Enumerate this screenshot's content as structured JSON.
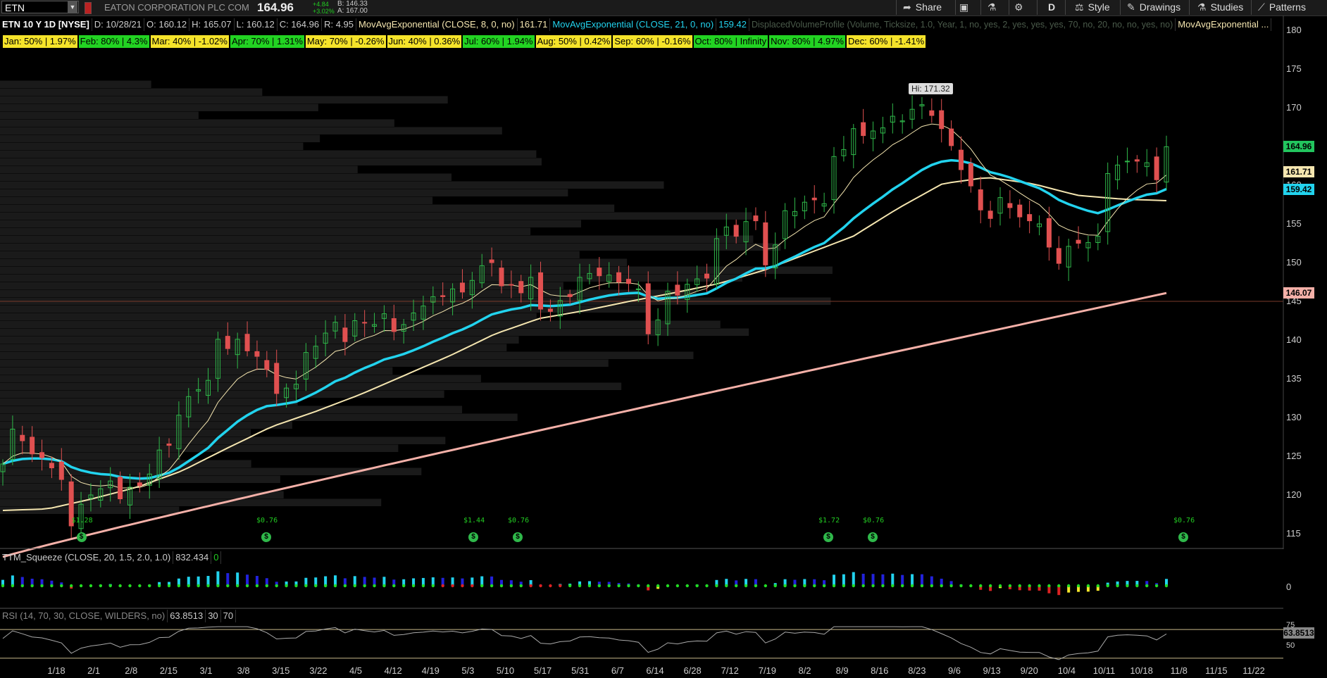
{
  "topbar": {
    "symbol": "ETN",
    "description": "EATON CORPORATION PLC COM",
    "last": "164.96",
    "change": "+4.84",
    "change_pct": "+3.02%",
    "bid": "B: 146.33",
    "ask": "A: 167.00",
    "buttons": {
      "share": "Share",
      "aggregation": "D",
      "style": "Style",
      "drawings": "Drawings",
      "studies": "Studies",
      "patterns": "Patterns"
    }
  },
  "infobar": {
    "title": "ETN 10 Y 1D [NYSE]",
    "date": "D: 10/28/21",
    "open": "O: 160.12",
    "high": "H: 165.07",
    "low": "L: 160.12",
    "close": "C: 164.96",
    "range": "R: 4.95",
    "ema8_label": "MovAvgExponential (CLOSE, 8, 0, no)",
    "ema8_value": "161.71",
    "ema21_label": "MovAvgExponential (CLOSE, 21, 0, no)",
    "ema21_value": "159.42",
    "dvp_label": "DisplacedVolumeProfile (Volume, Ticksize, 1.0, Year, 1, no, yes, 2, yes, yes, yes, 70, no, 20, no, no, yes, no)",
    "ema_more": "MovAvgExponential ..."
  },
  "seasonality": [
    {
      "text": "Jan: 50% | 1.97%",
      "color": "#f5e32a"
    },
    {
      "text": "Feb: 80% | 4.3%",
      "color": "#22d322"
    },
    {
      "text": "Mar: 40% | -1.02%",
      "color": "#f5e32a"
    },
    {
      "text": "Apr: 70% | 1.31%",
      "color": "#22d322"
    },
    {
      "text": "May: 70% | -0.26%",
      "color": "#f5e32a"
    },
    {
      "text": "Jun: 40% | 0.36%",
      "color": "#f5e32a"
    },
    {
      "text": "Jul: 60% | 1.94%",
      "color": "#22d322"
    },
    {
      "text": "Aug: 50% | 0.42%",
      "color": "#f5e32a"
    },
    {
      "text": "Sep: 60% | -0.16%",
      "color": "#f5e32a"
    },
    {
      "text": "Oct: 80% | Infinity",
      "color": "#22d322"
    },
    {
      "text": "Nov: 80% | 4.97%",
      "color": "#22d322"
    },
    {
      "text": "Dec: 60% | -1.41%",
      "color": "#f5e32a"
    }
  ],
  "price_tags": [
    {
      "value": "164.96",
      "color": "#22c55e"
    },
    {
      "value": "161.71",
      "color": "#f5e6b0"
    },
    {
      "value": "159.42",
      "color": "#22d3ee"
    },
    {
      "value": "146.07",
      "color": "#f4b0a8"
    }
  ],
  "hi_label": "Hi: 171.32",
  "events": [
    {
      "label": "$1.28"
    },
    {
      "label": "$0.76"
    },
    {
      "label": "$1.44"
    },
    {
      "label": "$0.76"
    },
    {
      "label": "$1.72"
    },
    {
      "label": "$0.76"
    },
    {
      "label": "$0.76"
    }
  ],
  "ttm": {
    "label": "TTM_Squeeze (CLOSE, 20, 1.5, 2.0, 1.0)",
    "value": "832.434",
    "flag": "0",
    "zero": "0"
  },
  "rsi": {
    "label": "RSI (14, 70, 30, CLOSE, WILDERS, no)",
    "value": "63.8513",
    "os": "30",
    "ob": "70",
    "tag": "63.8513",
    "t75": "75",
    "t50": "50"
  },
  "chart_data": {
    "type": "line",
    "title": "ETN 10 Y 1D [NYSE]",
    "ylim": [
      113,
      182
    ],
    "yticks": [
      115,
      120,
      125,
      130,
      135,
      140,
      145,
      150,
      155,
      160,
      165,
      170,
      175,
      180
    ],
    "xlabels": [
      "1/18",
      "2/1",
      "2/8",
      "2/15",
      "3/1",
      "3/8",
      "3/15",
      "3/22",
      "4/5",
      "4/12",
      "4/19",
      "5/3",
      "5/10",
      "5/17",
      "5/31",
      "6/7",
      "6/14",
      "6/28",
      "7/12",
      "7/19",
      "8/2",
      "8/9",
      "8/16",
      "8/23",
      "9/6",
      "9/13",
      "9/20",
      "10/4",
      "10/11",
      "10/18",
      "11/8",
      "11/15",
      "11/22"
    ],
    "close": [
      124.0,
      128.5,
      127.0,
      125.3,
      124.8,
      123.5,
      122.0,
      116.0,
      118.8,
      120.0,
      120.8,
      121.8,
      119.5,
      121.0,
      121.2,
      122.7,
      125.8,
      126.4,
      130.3,
      132.7,
      133.6,
      134.8,
      140.1,
      138.9,
      140.1,
      138.6,
      137.9,
      136.2,
      133.1,
      133.8,
      134.3,
      138.4,
      139.2,
      140.9,
      142.3,
      139.8,
      142.5,
      142.2,
      142.0,
      143.4,
      141.1,
      142.0,
      143.5,
      144.4,
      145.6,
      145.6,
      146.6,
      146.2,
      147.7,
      149.6,
      150.0,
      147.0,
      147.1,
      146.1,
      148.1,
      144.0,
      143.7,
      145.1,
      145.6,
      148.1,
      148.6,
      148.3,
      148.4,
      147.5,
      147.3,
      146.6,
      140.8,
      142.6,
      146.3,
      145.8,
      147.2,
      147.9,
      148.0,
      153.1,
      154.6,
      153.4,
      155.3,
      155.4,
      149.7,
      152.3,
      156.7,
      156.6,
      157.8,
      158.1,
      157.6,
      163.7,
      164.6,
      167.3,
      166.4,
      167.0,
      167.4,
      168.9,
      168.3,
      169.8,
      170.4,
      169.0,
      167.3,
      165.1,
      162.0,
      159.9,
      156.8,
      155.7,
      158.4,
      157.1,
      155.9,
      155.4,
      155.0,
      152.0,
      149.9,
      152.1,
      152.5,
      152.6,
      153.4,
      161.5,
      162.6,
      163.1,
      163.1,
      162.9,
      160.7,
      164.96
    ],
    "ema8_last": 161.71,
    "ema21_last": 159.42,
    "ema50_approx": [
      118.0,
      118.2,
      119.5,
      121.0,
      123.1,
      126.0,
      128.8,
      130.8,
      133.0,
      135.5,
      138.0,
      140.8,
      142.8,
      143.8,
      145.0,
      146.1,
      147.3,
      149.0,
      151.2,
      153.4,
      157.0,
      160.2,
      161.0,
      160.2,
      158.7,
      158.2,
      158.0
    ],
    "ema200_range": [
      112.0,
      146.07
    ],
    "high_marker": 171.32,
    "grid": false
  }
}
